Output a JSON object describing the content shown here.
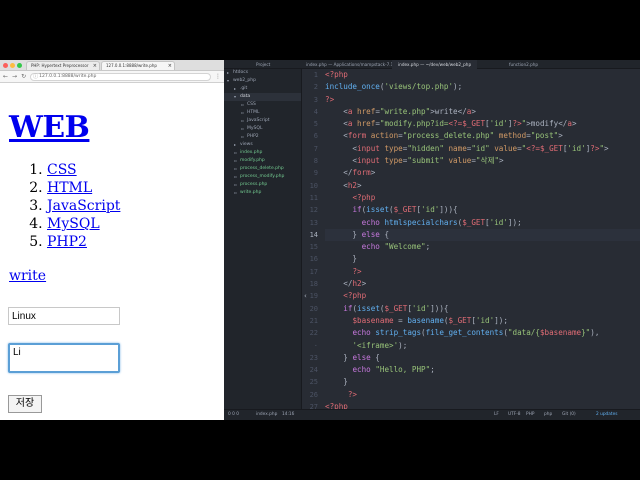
{
  "browser": {
    "tabs": [
      {
        "label": "PHP: Hypertext Preprocessor",
        "close": "×"
      },
      {
        "label": "127.0.0.1:8888/write.php",
        "close": "×"
      }
    ],
    "url": "127.0.0.1:8888/write.php",
    "page": {
      "heading": "WEB",
      "list": [
        "CSS",
        "HTML",
        "JavaScript",
        "MySQL",
        "PHP2"
      ],
      "write_link": "write",
      "title_value": "Linux",
      "description_value": "Li",
      "save_button": "저장"
    }
  },
  "editor": {
    "tabs": [
      {
        "label": "Project",
        "active": false
      },
      {
        "label": "index.php — Applications/mampstack-7.1...",
        "active": false
      },
      {
        "label": "index.php — ~/dev/web/web2_php",
        "active": true
      },
      {
        "label": "function2.php",
        "active": false
      }
    ],
    "tree": [
      {
        "label": "htdocs",
        "kind": "folder",
        "depth": 0
      },
      {
        "label": "web2_php",
        "kind": "folder-open",
        "depth": 0
      },
      {
        "label": ".git",
        "kind": "folder",
        "depth": 1
      },
      {
        "label": "data",
        "kind": "folder-open",
        "depth": 1
      },
      {
        "label": "CSS",
        "kind": "file",
        "depth": 2
      },
      {
        "label": "HTML",
        "kind": "file",
        "depth": 2
      },
      {
        "label": "JavaScript",
        "kind": "file",
        "depth": 2
      },
      {
        "label": "MySQL",
        "kind": "file",
        "depth": 2
      },
      {
        "label": "PHP2",
        "kind": "file",
        "depth": 2
      },
      {
        "label": "views",
        "kind": "folder",
        "depth": 1
      },
      {
        "label": "index.php",
        "kind": "file-green",
        "depth": 1
      },
      {
        "label": "modify.php",
        "kind": "file-green",
        "depth": 1
      },
      {
        "label": "process_delete.php",
        "kind": "file-green",
        "depth": 1
      },
      {
        "label": "process_modify.php",
        "kind": "file-green",
        "depth": 1
      },
      {
        "label": "process.php",
        "kind": "file-green",
        "depth": 1
      },
      {
        "label": "write.php",
        "kind": "file-green",
        "depth": 1
      }
    ],
    "line_numbers": [
      "1",
      "2",
      "3",
      "4",
      "5",
      "6",
      "7",
      "8",
      "9",
      "10",
      "11",
      "12",
      "13",
      "14",
      "15",
      "16",
      "17",
      "18",
      "19",
      "20",
      "21",
      "22",
      "·",
      "23",
      "24",
      "25",
      "26",
      "27"
    ],
    "current_line_index": 13,
    "status": {
      "left": "0  0  0",
      "file": "index.php",
      "position": "14:16",
      "eol": "LF",
      "encoding": "UTF-8",
      "grammar": "PHP",
      "branch": "php",
      "git": "Git (0)",
      "updates": "2 updates"
    }
  }
}
